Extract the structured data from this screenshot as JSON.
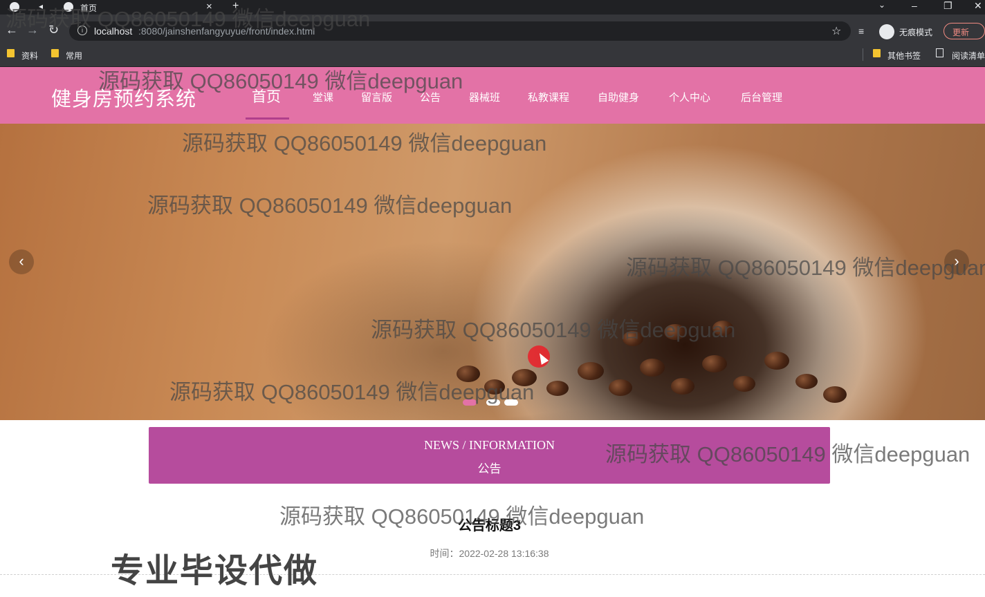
{
  "browser": {
    "tab_title": "首页",
    "url_host": "localhost",
    "url_rest": ":8080/jainshenfangyuyue/front/index.html",
    "incognito_label": "无痕模式",
    "update_label": "更新",
    "bookmarks": [
      {
        "label": "资料"
      },
      {
        "label": "常用"
      }
    ],
    "other_bookmarks_label": "其他书签",
    "reading_list_label": "阅读清单"
  },
  "header": {
    "site_title": "健身房预约系统",
    "nav": [
      {
        "label": "首页",
        "active": true
      },
      {
        "label": "堂课"
      },
      {
        "label": "留言版"
      },
      {
        "label": "公告"
      },
      {
        "label": "器械班"
      },
      {
        "label": "私教课程"
      },
      {
        "label": "自助健身"
      },
      {
        "label": "个人中心"
      },
      {
        "label": "后台管理"
      }
    ]
  },
  "carousel": {
    "prev_glyph": "‹",
    "next_glyph": "›",
    "slide_count": 3,
    "active_index": 0
  },
  "news": {
    "title_en": "NEWS / INFORMATION",
    "title_cn": "公告",
    "notice_title": "公告标题3",
    "time_label": "时间：",
    "time_value": "2022-02-28 13:16:38"
  },
  "watermark": {
    "text": "源码获取 QQ86050149 微信deepguan",
    "promo": "专业毕设代做"
  },
  "colors": {
    "header_bg": "#e372a6",
    "banner_bg": "#b64c9d",
    "nav_underline": "#b03f8c",
    "active_dot": "#e372a6"
  }
}
